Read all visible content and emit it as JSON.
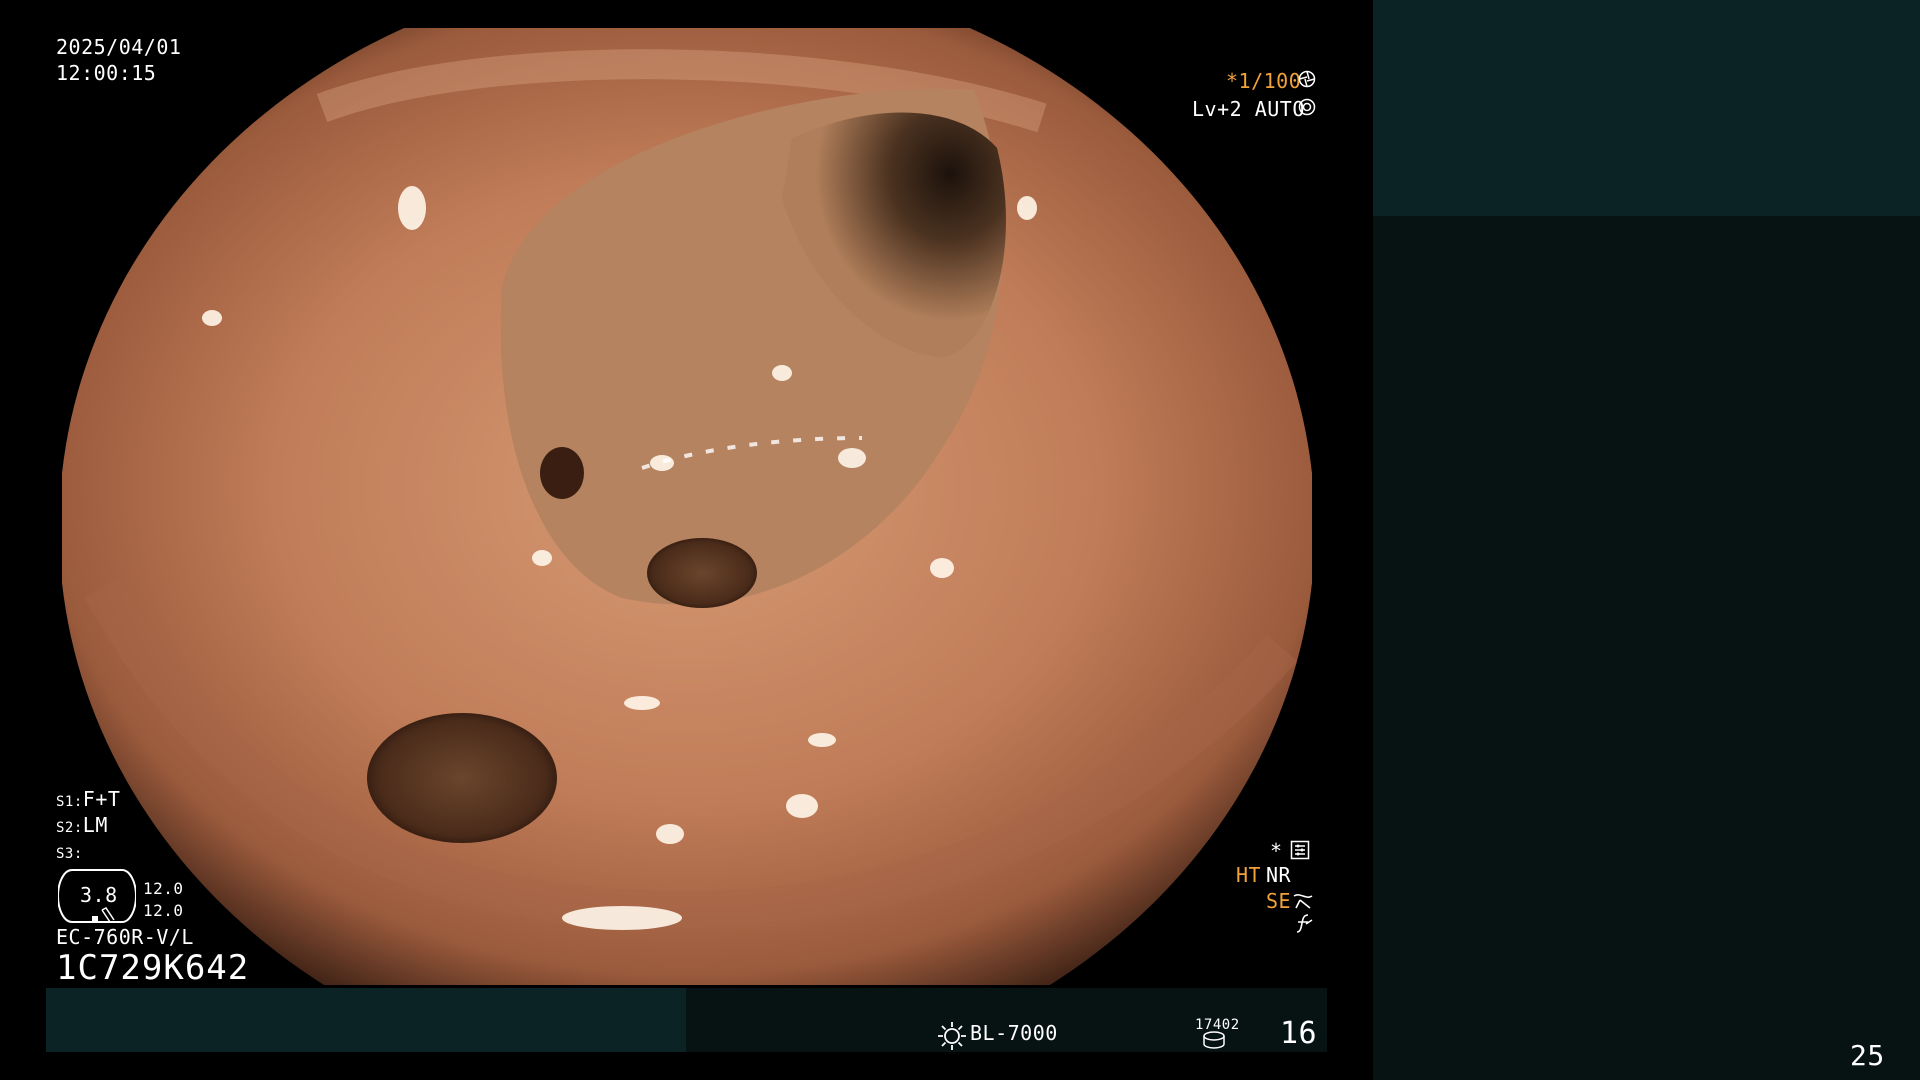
{
  "osd": {
    "date": "2025/04/01",
    "time": "12:00:15",
    "shutter": "*1/100",
    "level": "Lv+2 AUTO",
    "s1_label": "S1:",
    "s1_value": "F+T",
    "s2_label": "S2:",
    "s2_value": "LM",
    "s3_label": "S3:",
    "s3_value": "",
    "zoom": "3.8",
    "zoom_a": "12.0",
    "zoom_b": "12.0",
    "model": "EC-760R-V/L",
    "serial": "1C729K642",
    "star": "*",
    "ht": "HT",
    "nr": "NR",
    "se": "SE"
  },
  "bottom_bar": {
    "light_source": "BL-7000",
    "counter": "17402",
    "number": "16"
  },
  "page_number": "25",
  "colors": {
    "accent_orange": "#f2a23a",
    "panel_dark": "#071212",
    "panel_teal": "#0b2324"
  },
  "icons": [
    "shutter-icon",
    "auto-iris-icon",
    "menu-icon",
    "structure-enhance-icon",
    "freeze-icon",
    "sun-icon",
    "disk-icon"
  ]
}
